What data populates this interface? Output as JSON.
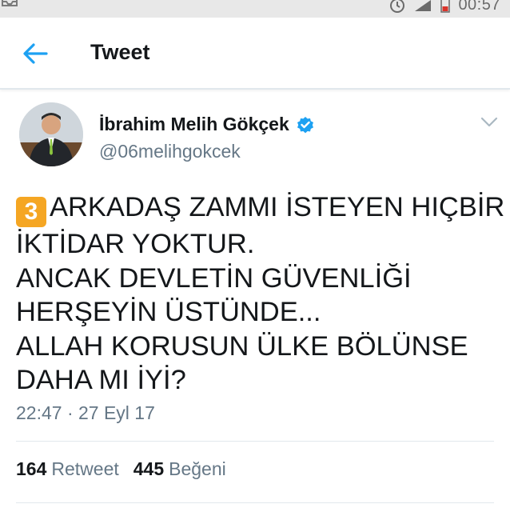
{
  "status_bar": {
    "time": "00:57",
    "icons": [
      "mail-icon",
      "alarm-icon",
      "signal-icon",
      "battery-icon"
    ]
  },
  "header": {
    "title": "Tweet",
    "back_icon": "arrow-left-icon"
  },
  "user": {
    "name": "İbrahim Melih Gökçek",
    "handle": "@06melihgokcek",
    "verified": true
  },
  "tweet": {
    "emoji_number": "3",
    "lines": [
      "ARKADAŞ ZAMMI İSTEYEN HIÇBİR",
      "İKTİDAR YOKTUR.",
      "ANCAK DEVLETİN GÜVENLİĞİ",
      "HERŞEYİN ÜSTÜNDE...",
      "ALLAH KORUSUN ÜLKE BÖLÜNSE",
      "DAHA MI İYİ?"
    ],
    "timestamp": "22:47 · 27 Eyl 17"
  },
  "stats": {
    "retweets": {
      "count": "164",
      "label": "Retweet"
    },
    "likes": {
      "count": "445",
      "label": "Beğeni"
    }
  },
  "colors": {
    "accent": "#1da1f2",
    "text": "#14171a",
    "secondary": "#657786",
    "keycap": "#f5a623"
  }
}
